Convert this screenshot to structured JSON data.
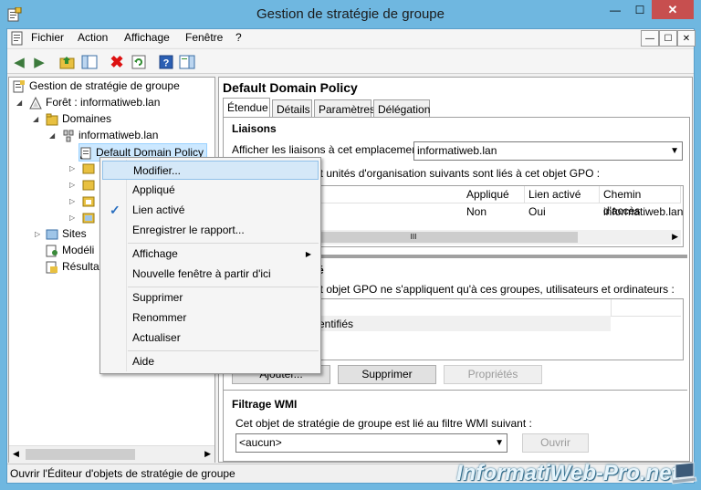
{
  "window": {
    "title": "Gestion de stratégie de groupe",
    "min_label": "—",
    "max_label": "☐",
    "close_label": "✕"
  },
  "menubar": {
    "items": [
      "Fichier",
      "Action",
      "Affichage",
      "Fenêtre",
      "?"
    ]
  },
  "tree": {
    "root": "Gestion de stratégie de groupe",
    "forest": "Forêt : informatiweb.lan",
    "domains": "Domaines",
    "domain": "informatiweb.lan",
    "gpo": "Default Domain Policy",
    "sites": "Sites",
    "modeling": "Modéli",
    "results": "Résulta"
  },
  "right": {
    "title": "Default Domain Policy",
    "tabs": [
      "Étendue",
      "Détails",
      "Paramètres",
      "Délégation"
    ],
    "links_title": "Liaisons",
    "show_links_label": "Afficher les liaisons à cet emplacement :",
    "location_value": "informatiweb.lan",
    "links_desc": "et unités d'organisation suivants sont liés à cet objet GPO :",
    "columns": [
      "Appliqué",
      "Lien activé",
      "Chemin d'accès"
    ],
    "row": {
      "enforced": "Non",
      "enabled": "Oui",
      "path": "informatiweb.lan"
    },
    "filter_title": "té",
    "filter_desc": "et objet GPO ne s'appliquent qu'à ces groupes, utilisateurs et ordinateurs :",
    "filter_item": "entifiés",
    "btn_add": "Ajouter...",
    "btn_remove": "Supprimer",
    "btn_props": "Propriétés",
    "wmi_title": "Filtrage WMI",
    "wmi_desc": "Cet objet de stratégie de groupe est lié au filtre WMI suivant :",
    "wmi_value": "<aucun>",
    "btn_open": "Ouvrir"
  },
  "context_menu": {
    "edit": "Modifier...",
    "enforced": "Appliqué",
    "link_enabled": "Lien activé",
    "save_report": "Enregistrer le rapport...",
    "view": "Affichage",
    "new_window": "Nouvelle fenêtre à partir d'ici",
    "delete": "Supprimer",
    "rename": "Renommer",
    "refresh": "Actualiser",
    "help": "Aide",
    "check_glyph": "✓",
    "submenu_arrow": "▶"
  },
  "status": {
    "text": "Ouvrir l'Éditeur d'objets de stratégie de groupe"
  },
  "watermark": {
    "text": "InformatiWeb-Pro.net"
  },
  "colors": {
    "titlebar": "#6fb7e0",
    "close": "#c74f4f",
    "highlight": "#cde8ff",
    "check": "#2a6fc0"
  }
}
